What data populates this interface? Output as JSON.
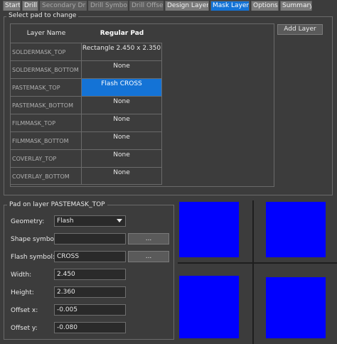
{
  "tabs": [
    {
      "label": "Start",
      "state": "normal"
    },
    {
      "label": "Drill",
      "state": "normal"
    },
    {
      "label": "Secondary Drill",
      "state": "disabled"
    },
    {
      "label": "Drill Symbol",
      "state": "disabled"
    },
    {
      "label": "Drill Offset",
      "state": "disabled"
    },
    {
      "label": "Design Layers",
      "state": "normal"
    },
    {
      "label": "Mask Layers",
      "state": "active"
    },
    {
      "label": "Options",
      "state": "normal"
    },
    {
      "label": "Summary",
      "state": "normal"
    }
  ],
  "select_group": {
    "title": "Select pad to change",
    "columns": [
      "Layer Name",
      "Regular Pad"
    ],
    "rows": [
      {
        "layer": "SOLDERMASK_TOP",
        "pad": "Rectangle 2.450 x 2.350"
      },
      {
        "layer": "SOLDERMASK_BOTTOM",
        "pad": "None"
      },
      {
        "layer": "PASTEMASK_TOP",
        "pad": "Flash CROSS",
        "selected": true
      },
      {
        "layer": "PASTEMASK_BOTTOM",
        "pad": "None"
      },
      {
        "layer": "FILMMASK_TOP",
        "pad": "None"
      },
      {
        "layer": "FILMMASK_BOTTOM",
        "pad": "None"
      },
      {
        "layer": "COVERLAY_TOP",
        "pad": "None"
      },
      {
        "layer": "COVERLAY_BOTTOM",
        "pad": "None"
      }
    ],
    "add_layer_label": "Add Layer"
  },
  "pad_group": {
    "title": "Pad on layer PASTEMASK_TOP",
    "geometry_label": "Geometry:",
    "geometry_value": "Flash",
    "shape_symbol_label": "Shape symbol:",
    "shape_symbol_value": "",
    "flash_symbol_label": "Flash symbol:",
    "flash_symbol_value": "CROSS",
    "browse_label": "...",
    "width_label": "Width:",
    "width_value": "2.450",
    "height_label": "Height:",
    "height_value": "2.360",
    "offset_x_label": "Offset x:",
    "offset_x_value": "-0.005",
    "offset_y_label": "Offset y:",
    "offset_y_value": "-0.080"
  },
  "colors": {
    "accent": "#1473d6",
    "pad_fill": "#0000ff",
    "background": "#3c3c3c"
  }
}
